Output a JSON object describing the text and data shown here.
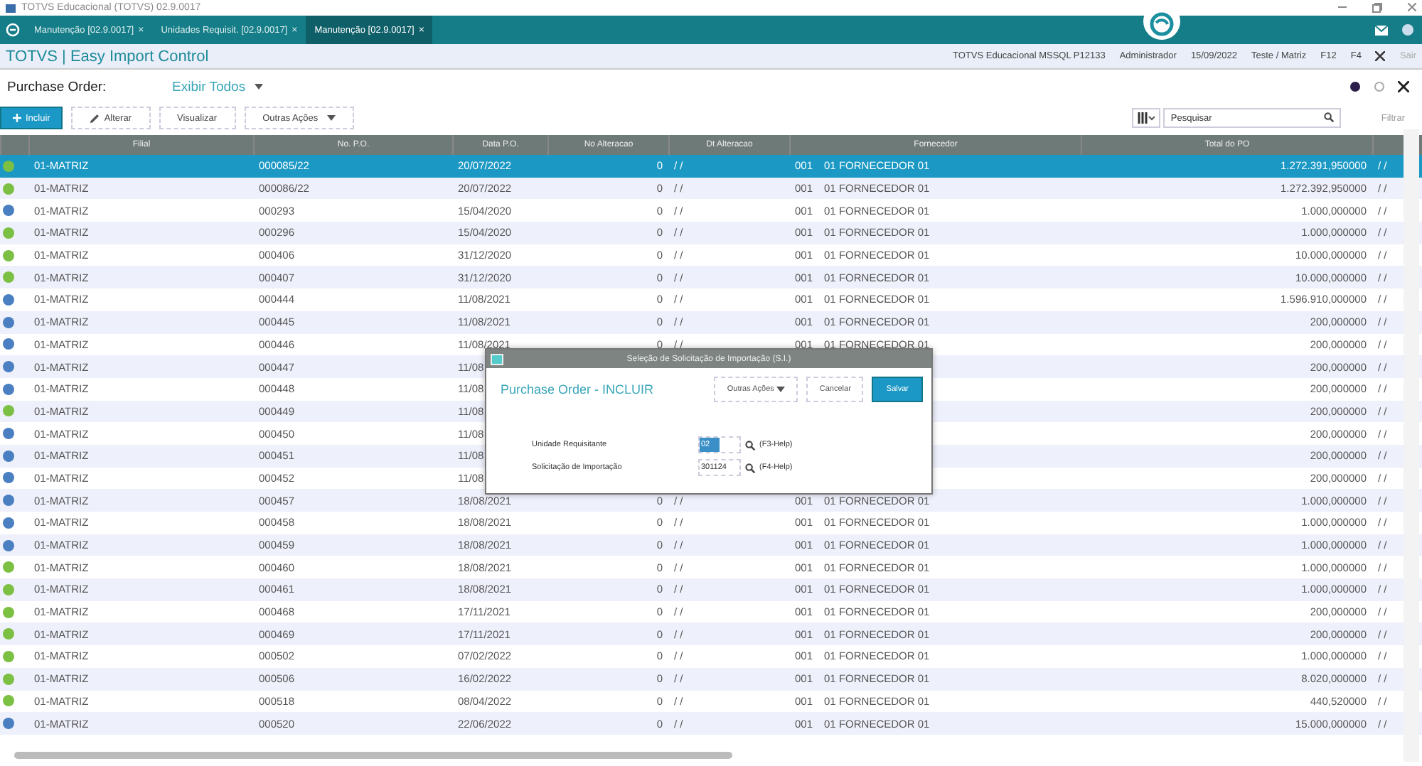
{
  "window": {
    "title": "TOTVS Educacional (TOTVS) 02.9.0017"
  },
  "tabs": [
    {
      "label": "Manutenção [02.9.0017]",
      "close": "×",
      "selected": false
    },
    {
      "label": "Unidades Requisit. [02.9.0017]",
      "close": "×",
      "selected": false
    },
    {
      "label": "Manutenção [02.9.0017]",
      "close": "×",
      "selected": true
    }
  ],
  "app_header": {
    "title": "TOTVS | Easy Import Control",
    "info": [
      "TOTVS Educacional MSSQL P12133",
      "Administrador",
      "15/09/2022",
      "Teste / Matriz",
      "F12",
      "F4"
    ],
    "exit": "Sair"
  },
  "page": {
    "title": "Purchase Order:",
    "view": "Exibir Todos"
  },
  "toolbar": {
    "buttons": [
      {
        "label": "Incluir",
        "kind": "primary"
      },
      {
        "label": "Alterar",
        "kind": "edit"
      },
      {
        "label": "Visualizar",
        "kind": "plain"
      },
      {
        "label": "Outras Ações",
        "kind": "menu"
      }
    ],
    "search": {
      "placeholder": "Pesquisar"
    },
    "filter": "Filtrar"
  },
  "table": {
    "columns": [
      "Filial",
      "No. P.O.",
      "Data P.O.",
      "No Alteracao",
      "Dt Alteracao",
      "Fornecedor",
      "Total do PO"
    ],
    "rows": [
      {
        "color": "#7bc043",
        "selected": true,
        "filial": "01-MATRIZ",
        "po": "000085/22",
        "date": "20/07/2022",
        "alterations": "0",
        "alt_date": "/ /",
        "supplier_code": "001",
        "supplier": "01 FORNECEDOR 01",
        "total": "1.272.391,950000",
        "column_9": "/ /"
      },
      {
        "color": "#7bc043",
        "selected": false,
        "filial": "01-MATRIZ",
        "po": "000086/22",
        "date": "20/07/2022",
        "alterations": "0",
        "alt_date": "/ /",
        "supplier_code": "001",
        "supplier": "01 FORNECEDOR 01",
        "total": "1.272.392,950000",
        "column_9": "/ /"
      },
      {
        "color": "#4a7fc1",
        "selected": false,
        "filial": "01-MATRIZ",
        "po": "000293",
        "date": "15/04/2020",
        "alterations": "0",
        "alt_date": "/ /",
        "supplier_code": "001",
        "supplier": "01 FORNECEDOR 01",
        "total": "1.000,000000",
        "column_9": "/ /"
      },
      {
        "color": "#7bc043",
        "selected": false,
        "filial": "01-MATRIZ",
        "po": "000296",
        "date": "15/04/2020",
        "alterations": "0",
        "alt_date": "/ /",
        "supplier_code": "001",
        "supplier": "01 FORNECEDOR 01",
        "total": "1.000,000000",
        "column_9": "/ /"
      },
      {
        "color": "#7bc043",
        "selected": false,
        "filial": "01-MATRIZ",
        "po": "000406",
        "date": "31/12/2020",
        "alterations": "0",
        "alt_date": "/ /",
        "supplier_code": "001",
        "supplier": "01 FORNECEDOR 01",
        "total": "10.000,000000",
        "column_9": "/ /"
      },
      {
        "color": "#7bc043",
        "selected": false,
        "filial": "01-MATRIZ",
        "po": "000407",
        "date": "31/12/2020",
        "alterations": "0",
        "alt_date": "/ /",
        "supplier_code": "001",
        "supplier": "01 FORNECEDOR 01",
        "total": "10.000,000000",
        "column_9": "/ /"
      },
      {
        "color": "#4a7fc1",
        "selected": false,
        "filial": "01-MATRIZ",
        "po": "000444",
        "date": "11/08/2021",
        "alterations": "0",
        "alt_date": "/ /",
        "supplier_code": "001",
        "supplier": "01 FORNECEDOR 01",
        "total": "1.596.910,000000",
        "column_9": "/ /"
      },
      {
        "color": "#4a7fc1",
        "selected": false,
        "filial": "01-MATRIZ",
        "po": "000445",
        "date": "11/08/2021",
        "alterations": "0",
        "alt_date": "/ /",
        "supplier_code": "001",
        "supplier": "01 FORNECEDOR 01",
        "total": "200,000000",
        "column_9": "/ /"
      },
      {
        "color": "#4a7fc1",
        "selected": false,
        "filial": "01-MATRIZ",
        "po": "000446",
        "date": "11/08/2021",
        "alterations": "0",
        "alt_date": "/ /",
        "supplier_code": "001",
        "supplier": "01 FORNECEDOR 01",
        "total": "200,000000",
        "column_9": "/ /"
      },
      {
        "color": "#4a7fc1",
        "selected": false,
        "filial": "01-MATRIZ",
        "po": "000447",
        "date": "11/08",
        "total": "200,000000",
        "column_9": "/ /"
      },
      {
        "color": "#4a7fc1",
        "selected": false,
        "filial": "01-MATRIZ",
        "po": "000448",
        "date": "11/08",
        "total": "200,000000",
        "column_9": "/ /"
      },
      {
        "color": "#7bc043",
        "selected": false,
        "filial": "01-MATRIZ",
        "po": "000449",
        "date": "11/08",
        "total": "200,000000",
        "column_9": "/ /"
      },
      {
        "color": "#4a7fc1",
        "selected": false,
        "filial": "01-MATRIZ",
        "po": "000450",
        "date": "11/08",
        "total": "200,000000",
        "column_9": "/ /"
      },
      {
        "color": "#4a7fc1",
        "selected": false,
        "filial": "01-MATRIZ",
        "po": "000451",
        "date": "11/08",
        "total": "200,000000",
        "column_9": "/ /"
      },
      {
        "color": "#4a7fc1",
        "selected": false,
        "filial": "01-MATRIZ",
        "po": "000452",
        "date": "11/08",
        "total": "200,000000",
        "column_9": "/ /"
      },
      {
        "color": "#4a7fc1",
        "selected": false,
        "filial": "01-MATRIZ",
        "po": "000457",
        "date": "18/08/2021",
        "alterations": "0",
        "alt_date": "/ /",
        "supplier_code": "001",
        "supplier": "01 FORNECEDOR 01",
        "total": "1.000,000000",
        "column_9": "/ /"
      },
      {
        "color": "#4a7fc1",
        "selected": false,
        "filial": "01-MATRIZ",
        "po": "000458",
        "date": "18/08/2021",
        "alterations": "0",
        "alt_date": "/ /",
        "supplier_code": "001",
        "supplier": "01 FORNECEDOR 01",
        "total": "1.000,000000",
        "column_9": "/ /"
      },
      {
        "color": "#4a7fc1",
        "selected": false,
        "filial": "01-MATRIZ",
        "po": "000459",
        "date": "18/08/2021",
        "alterations": "0",
        "alt_date": "/ /",
        "supplier_code": "001",
        "supplier": "01 FORNECEDOR 01",
        "total": "1.000,000000",
        "column_9": "/ /"
      },
      {
        "color": "#7bc043",
        "selected": false,
        "filial": "01-MATRIZ",
        "po": "000460",
        "date": "18/08/2021",
        "alterations": "0",
        "alt_date": "/ /",
        "supplier_code": "001",
        "supplier": "01 FORNECEDOR 01",
        "total": "1.000,000000",
        "column_9": "/ /"
      },
      {
        "color": "#7bc043",
        "selected": false,
        "filial": "01-MATRIZ",
        "po": "000461",
        "date": "18/08/2021",
        "alterations": "0",
        "alt_date": "/ /",
        "supplier_code": "001",
        "supplier": "01 FORNECEDOR 01",
        "total": "1.000,000000",
        "column_9": "/ /"
      },
      {
        "color": "#7bc043",
        "selected": false,
        "filial": "01-MATRIZ",
        "po": "000468",
        "date": "17/11/2021",
        "alterations": "0",
        "alt_date": "/ /",
        "supplier_code": "001",
        "supplier": "01 FORNECEDOR 01",
        "total": "200,000000",
        "column_9": "/ /"
      },
      {
        "color": "#7bc043",
        "selected": false,
        "filial": "01-MATRIZ",
        "po": "000469",
        "date": "17/11/2021",
        "alterations": "0",
        "alt_date": "/ /",
        "supplier_code": "001",
        "supplier": "01 FORNECEDOR 01",
        "total": "200,000000",
        "column_9": "/ /"
      },
      {
        "color": "#7bc043",
        "selected": false,
        "filial": "01-MATRIZ",
        "po": "000502",
        "date": "07/02/2022",
        "alterations": "0",
        "alt_date": "/ /",
        "supplier_code": "001",
        "supplier": "01 FORNECEDOR 01",
        "total": "1.000,000000",
        "column_9": "/ /"
      },
      {
        "color": "#7bc043",
        "selected": false,
        "filial": "01-MATRIZ",
        "po": "000506",
        "date": "16/02/2022",
        "alterations": "0",
        "alt_date": "/ /",
        "supplier_code": "001",
        "supplier": "01 FORNECEDOR 01",
        "total": "8.020,000000",
        "column_9": "/ /"
      },
      {
        "color": "#7bc043",
        "selected": false,
        "filial": "01-MATRIZ",
        "po": "000518",
        "date": "08/04/2022",
        "alterations": "0",
        "alt_date": "/ /",
        "supplier_code": "001",
        "supplier": "01 FORNECEDOR 01",
        "total": "440,520000",
        "column_9": "/ /"
      },
      {
        "color": "#4a7fc1",
        "selected": false,
        "filial": "01-MATRIZ",
        "po": "000520",
        "date": "22/06/2022",
        "alterations": "0",
        "alt_date": "/ /",
        "supplier_code": "001",
        "supplier": "01 FORNECEDOR 01",
        "total": "15.000,000000",
        "column_9": "/ /"
      }
    ]
  },
  "dialog": {
    "title": "Seleção de Solicitação de Importação (S.I.)",
    "heading": "Purchase Order - INCLUIR",
    "buttons": [
      {
        "label": "Outras Ações",
        "kind": "menu"
      },
      {
        "label": "Cancelar",
        "kind": "plain"
      },
      {
        "label": "Salvar",
        "kind": "primary"
      }
    ],
    "fields": [
      {
        "label": "Unidade Requisitante",
        "value": "02",
        "help": "(F3-Help)",
        "selected": true
      },
      {
        "label": "Solicitação de Importação",
        "value": "301124",
        "help": "(F4-Help)",
        "selected": false
      }
    ]
  }
}
